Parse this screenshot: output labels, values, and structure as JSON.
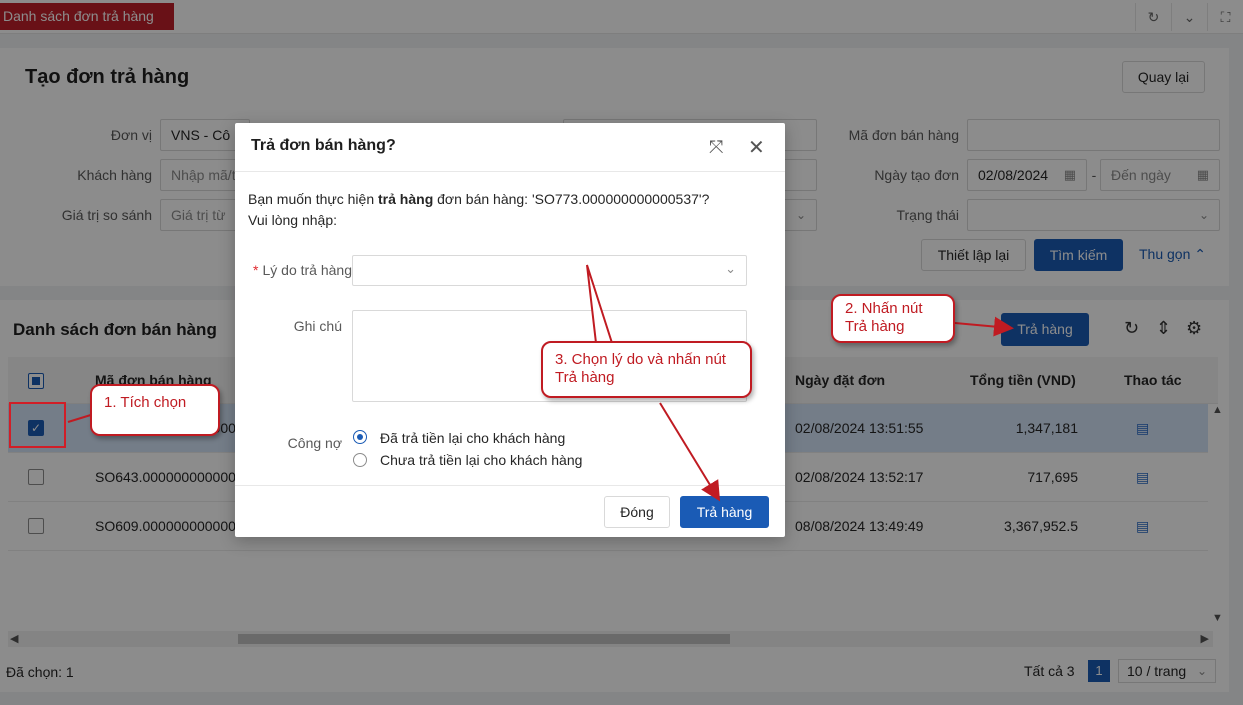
{
  "top_tab": {
    "title": "Danh sách đơn trả hàng"
  },
  "top_icons": [
    "refresh-icon",
    "chevron-down-icon",
    "fullscreen-icon"
  ],
  "page": {
    "title": "Tạo đơn trả hàng",
    "back_button": "Quay lại"
  },
  "filters": {
    "don_vi_label": "Đơn vị",
    "don_vi_value": "VNS - Cô",
    "khach_hang_label": "Khách hàng",
    "khach_hang_placeholder": "Nhập mã/t",
    "gia_tri_label": "Giá trị so sánh",
    "gia_tri_placeholder": "Giá trị từ",
    "ma_don_label": "Mã đơn bán hàng",
    "ngay_tao_label": "Ngày tạo đơn",
    "ngay_tao_from": "02/08/2024",
    "ngay_tao_sep": "-",
    "ngay_tao_to_placeholder": "Đến ngày",
    "trang_thai_label": "Trạng thái",
    "reset_button": "Thiết lập lại",
    "search_button": "Tìm kiếm",
    "collapse_link": "Thu gọn"
  },
  "list": {
    "title": "Danh sách đơn bán hàng",
    "return_button": "Trả hàng",
    "columns": {
      "code": "Mã đơn bán hàng",
      "date": "Ngày đặt đơn",
      "total": "Tổng tiền (VND)",
      "action": "Thao tác"
    },
    "rows": [
      {
        "code": "SO773.000000000000",
        "date": "02/08/2024 13:51:55",
        "total": "1,347,181",
        "selected": true
      },
      {
        "code": "SO643.000000000000",
        "date": "02/08/2024 13:52:17",
        "total": "717,695",
        "selected": false
      },
      {
        "code": "SO609.000000000000",
        "date": "08/08/2024 13:49:49",
        "total": "3,367,952.5",
        "selected": false
      }
    ],
    "selected_text": "Đã chọn: 1",
    "total_text": "Tất cả 3",
    "current_page": "1",
    "page_size": "10 / trang"
  },
  "modal": {
    "title": "Trả đơn bán hàng?",
    "msg_prefix": "Bạn muốn thực hiện ",
    "msg_bold": "trả hàng",
    "msg_suffix": " đơn bán hàng: 'SO773.000000000000537'?",
    "msg_line2": "Vui lòng nhập:",
    "reason_label": "Lý do trả hàng",
    "reason_required": "*",
    "note_label": "Ghi chú",
    "debt_label": "Công nợ",
    "debt_options": [
      "Đã trả tiền lại cho khách hàng",
      "Chưa trả tiền lại cho khách hàng"
    ],
    "debt_selected_index": 0,
    "close_button": "Đóng",
    "submit_button": "Trả hàng"
  },
  "callouts": {
    "step1": "1. Tích chọn",
    "step2_line1": "2. Nhấn nút",
    "step2_line2": "Trả hàng",
    "step3_line1": "3. Chọn lý do và nhấn nút",
    "step3_line2": "Trả hàng"
  },
  "colors": {
    "primary": "#1a5bb5",
    "tab_red": "#c0202a",
    "callout_red": "#c01b22",
    "selected_row": "#d4e3f8"
  }
}
